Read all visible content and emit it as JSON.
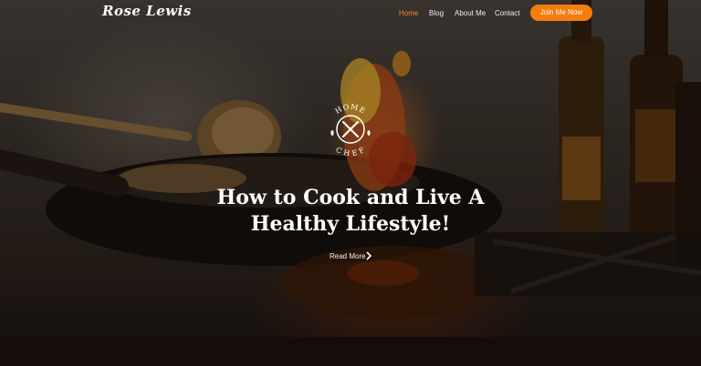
{
  "header": {
    "logo_text": "Rose Lewis",
    "nav": [
      {
        "label": "Home",
        "active": true
      },
      {
        "label": "Blog"
      },
      {
        "label": "About Me"
      },
      {
        "label": "Contact"
      }
    ],
    "cta_label": "Join Me Now"
  },
  "hero": {
    "badge": {
      "top_text": "HOME",
      "bottom_text": "CHEF",
      "icon": "crossed-utensils-icon"
    },
    "headline_line1": "How to Cook and Live A",
    "headline_line2": "Healthy Lifestyle!",
    "read_more_label": "Read More",
    "read_more_icon": "chevron-right-icon"
  },
  "colors": {
    "accent": "#f57c0d",
    "active_nav": "#f28a1e",
    "text": "#ffffff"
  }
}
